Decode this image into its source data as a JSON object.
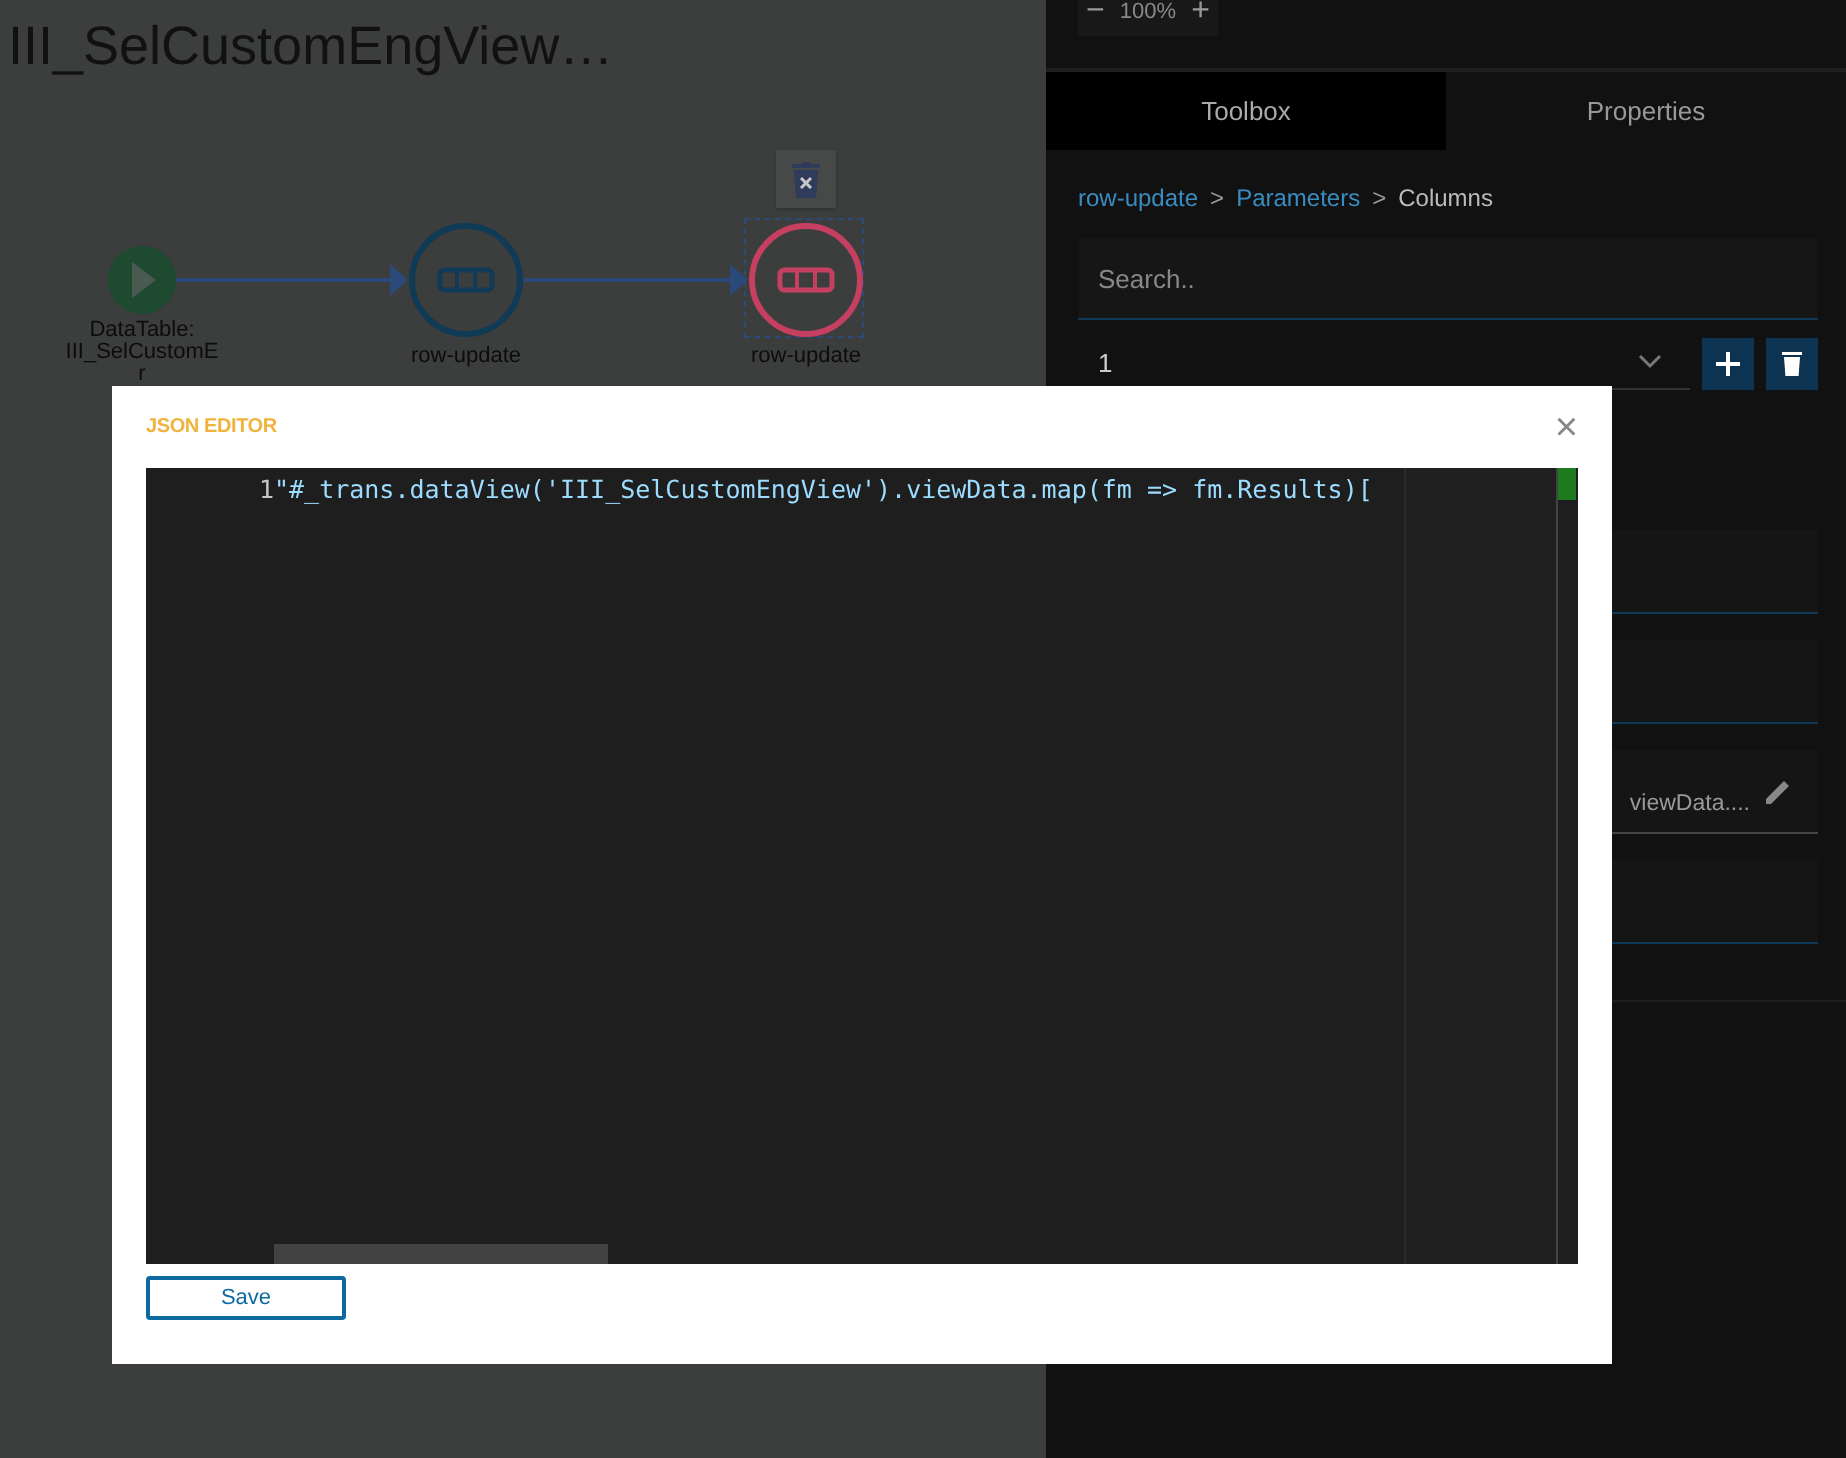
{
  "title": "III_SelCustomEngView…",
  "diagram": {
    "nodes": [
      {
        "kind": "start",
        "label_lines": [
          "DataTable:",
          "III_SelCustomE",
          "r"
        ],
        "selected": false
      },
      {
        "kind": "step",
        "label_lines": [
          "row-update"
        ],
        "selected": false
      },
      {
        "kind": "step",
        "label_lines": [
          "row-update"
        ],
        "selected": true
      }
    ]
  },
  "zoom": {
    "minus": "−",
    "value": "100%",
    "plus": "+"
  },
  "tabs": [
    {
      "label": "Toolbox",
      "selected": true
    },
    {
      "label": "Properties",
      "selected": false
    }
  ],
  "breadcrumb": [
    {
      "kind": "link",
      "label": "row-update"
    },
    {
      "kind": "separator",
      "label": ">"
    },
    {
      "kind": "link",
      "label": "Parameters"
    },
    {
      "kind": "separator",
      "label": ">"
    },
    {
      "kind": "current",
      "label": "Columns"
    }
  ],
  "search": {
    "placeholder": "Search.."
  },
  "column_select": {
    "value": "1"
  },
  "field": {
    "value": "viewData...."
  },
  "dialog": {
    "title": "JSON EDITOR",
    "close": "×",
    "editor": {
      "line_number": "1",
      "code": "\"#_trans.dataView('III_SelCustomEngView').viewData.map(fm => fm.Results)["
    },
    "save": "Save"
  }
}
